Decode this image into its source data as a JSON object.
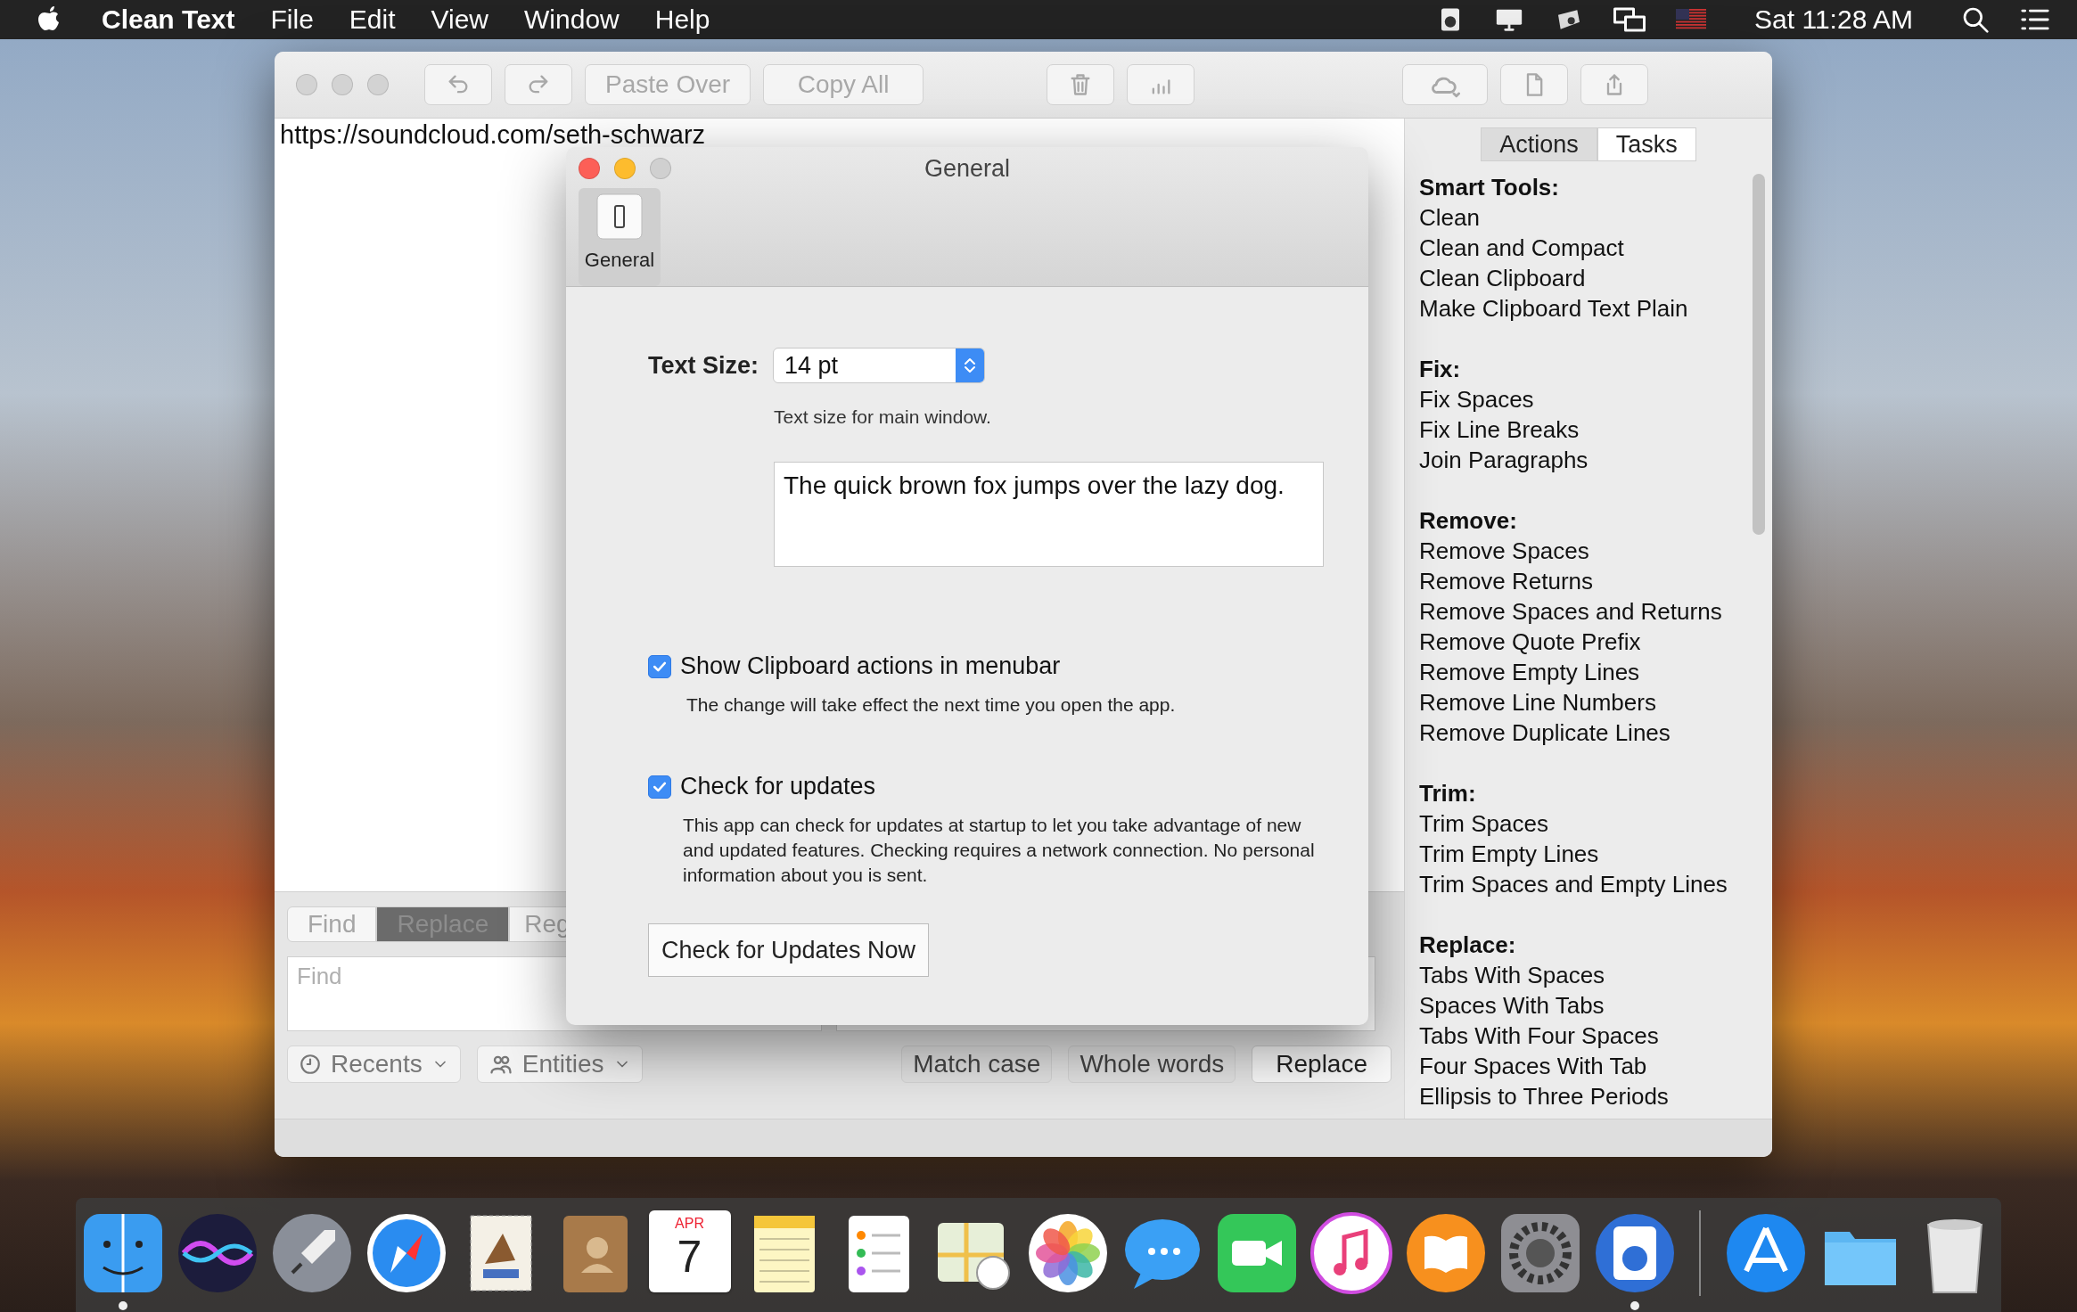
{
  "menubar": {
    "app_name": "Clean Text",
    "menus": [
      "File",
      "Edit",
      "View",
      "Window",
      "Help"
    ],
    "clock": "Sat 11:28 AM"
  },
  "window": {
    "toolbar": {
      "buttons": [
        "Paste Over",
        "Copy All"
      ]
    },
    "document_text": "https://soundcloud.com/seth-schwarz",
    "find_bar": {
      "tabs": [
        {
          "label": "Find",
          "selected": false
        },
        {
          "label": "Replace",
          "selected": true
        },
        {
          "label": "Reg",
          "selected": false
        }
      ],
      "find_placeholder": "Find",
      "dropdowns": [
        "Recents",
        "Entities"
      ],
      "options": [
        "Match case",
        "Whole words"
      ],
      "action": "Replace"
    },
    "sidebar": {
      "tabs": [
        {
          "label": "Actions",
          "selected": true
        },
        {
          "label": "Tasks",
          "selected": false
        }
      ],
      "sections": [
        {
          "title": "Smart Tools:",
          "items": [
            "Clean",
            "Clean and Compact",
            "Clean Clipboard",
            "Make Clipboard Text Plain"
          ]
        },
        {
          "title": "Fix:",
          "items": [
            "Fix Spaces",
            "Fix Line Breaks",
            "Join Paragraphs"
          ]
        },
        {
          "title": "Remove:",
          "items": [
            "Remove Spaces",
            "Remove Returns",
            "Remove Spaces and Returns",
            "Remove Quote Prefix",
            "Remove Empty Lines",
            "Remove Line Numbers",
            "Remove Duplicate Lines"
          ]
        },
        {
          "title": "Trim:",
          "items": [
            "Trim Spaces",
            "Trim Empty Lines",
            "Trim Spaces and Empty Lines"
          ]
        },
        {
          "title": "Replace:",
          "items": [
            "Tabs With Spaces",
            "Spaces With Tabs",
            "Tabs With Four Spaces",
            "Four Spaces With Tab",
            "Ellipsis to Three Periods"
          ]
        }
      ]
    }
  },
  "dialog": {
    "title": "General",
    "toolbar_item": {
      "label": "General",
      "selected": true
    },
    "text_size": {
      "label": "Text Size:",
      "value": "14 pt",
      "hint": "Text size for main window."
    },
    "preview": "The quick brown fox jumps over the lazy dog.",
    "options": [
      {
        "label": "Show Clipboard actions in menubar",
        "checked": true,
        "note": "The change will take effect the next time you open the app."
      },
      {
        "label": "Check for updates",
        "checked": true,
        "note": "This app can check for updates at startup to let you take advantage of new and updated features. Checking requires a network connection. No personal information about you is sent."
      }
    ],
    "button": "Check for Updates Now"
  },
  "dock": {
    "calendar": {
      "month": "APR",
      "day": "7"
    },
    "apps": [
      {
        "kind": "finder",
        "running": true
      },
      {
        "kind": "siri",
        "running": false
      },
      {
        "kind": "launchpad",
        "running": false
      },
      {
        "kind": "safari",
        "running": false
      },
      {
        "kind": "mail",
        "running": false
      },
      {
        "kind": "contacts",
        "running": false
      },
      {
        "kind": "calendar",
        "running": false
      },
      {
        "kind": "notes",
        "running": false
      },
      {
        "kind": "reminders",
        "running": false
      },
      {
        "kind": "maps",
        "running": false
      },
      {
        "kind": "photos",
        "running": false
      },
      {
        "kind": "messages",
        "running": false
      },
      {
        "kind": "facetime",
        "running": false
      },
      {
        "kind": "music",
        "running": false
      },
      {
        "kind": "books",
        "running": false
      },
      {
        "kind": "settings",
        "running": false
      },
      {
        "kind": "cleantext",
        "running": true
      },
      {
        "kind": "separator"
      },
      {
        "kind": "appstore",
        "running": false
      },
      {
        "kind": "folder",
        "running": false
      },
      {
        "kind": "trash",
        "running": false
      }
    ]
  }
}
